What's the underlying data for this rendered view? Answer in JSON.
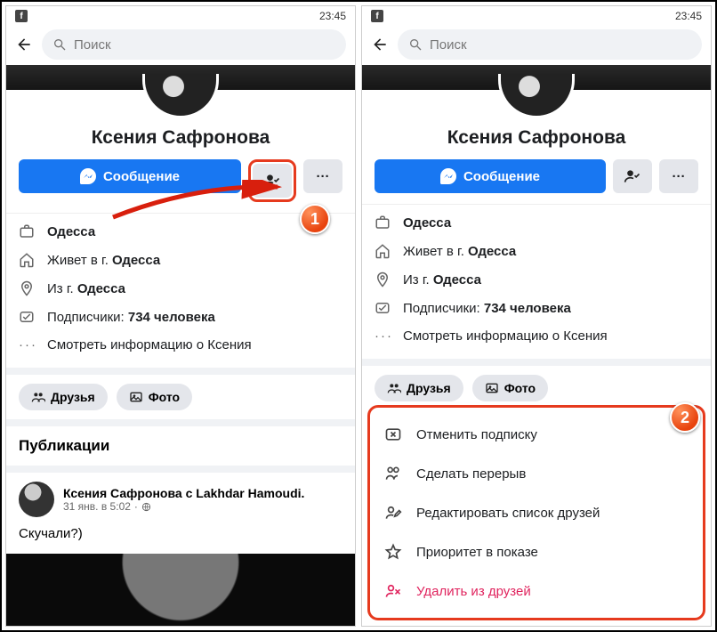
{
  "statusbar": {
    "time": "23:45"
  },
  "search": {
    "placeholder": "Поиск"
  },
  "profile": {
    "name": "Ксения Сафронова",
    "message_btn": "Сообщение"
  },
  "info": {
    "work": "Одесса",
    "lives_prefix": "Живет в г. ",
    "lives_city": "Одесса",
    "from_prefix": "Из г. ",
    "from_city": "Одесса",
    "followers_prefix": "Подписчики: ",
    "followers_value": "734 человека",
    "about": "Смотреть информацию о Ксения"
  },
  "chips": {
    "friends": "Друзья",
    "photos": "Фото"
  },
  "posts": {
    "heading": "Публикации",
    "item": {
      "author": "Ксения Сафронова",
      "with_word": " с ",
      "tagged": "Lakhdar Hamoudi",
      "date": "31 янв. в 5:02",
      "text": "Скучали?)"
    }
  },
  "sheet": {
    "unfollow": "Отменить подписку",
    "snooze": "Сделать перерыв",
    "edit_list": "Редактировать список друзей",
    "priority": "Приоритет в показе",
    "unfriend": "Удалить из друзей"
  },
  "callouts": {
    "one": "1",
    "two": "2"
  }
}
